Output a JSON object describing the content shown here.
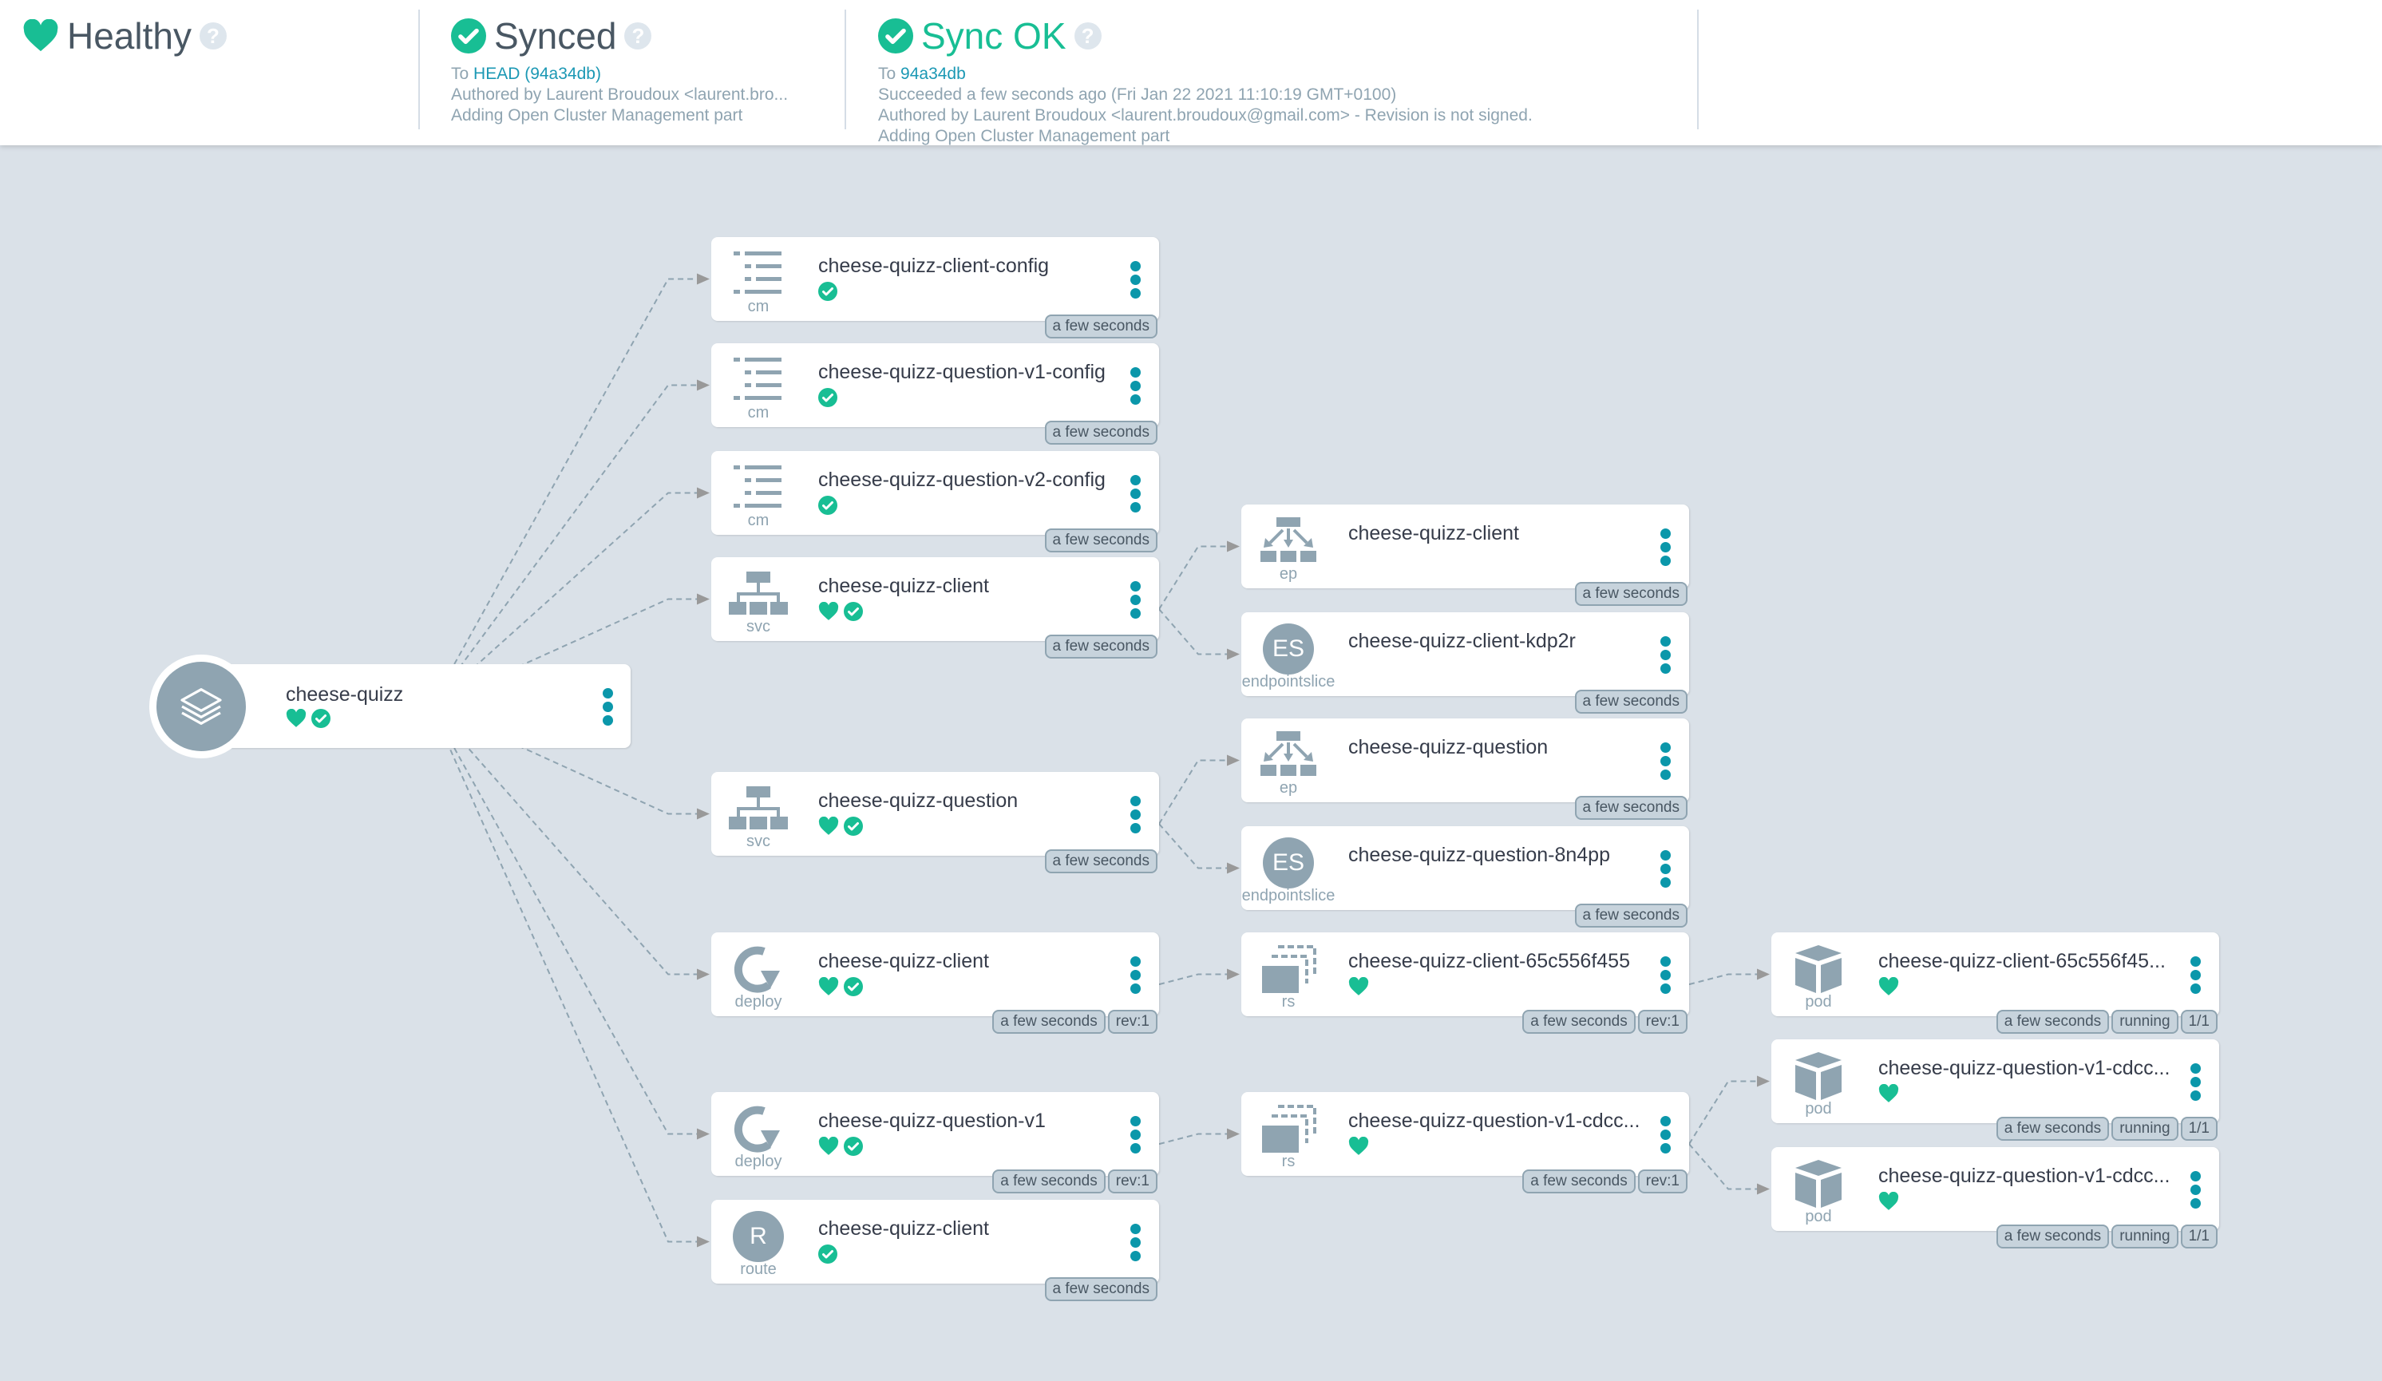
{
  "colors": {
    "healthy": "#18be94",
    "accent": "#0b97aa",
    "icon": "#8fa4b1",
    "link": "#0dadea"
  },
  "header": {
    "health": {
      "title": "Healthy",
      "icon": "heart-icon",
      "help_icon": "question-icon"
    },
    "sync": {
      "title": "Synced",
      "icon": "check-circle-icon",
      "to_prefix": "To",
      "to_link": "HEAD (94a34db)",
      "author": "Authored by Laurent Broudoux <laurent.bro...",
      "message": "Adding Open Cluster Management part"
    },
    "operation": {
      "title": "Sync OK",
      "icon": "check-circle-icon",
      "to_prefix": "To",
      "to_link": "94a34db",
      "succeeded": "Succeeded a few seconds ago (Fri Jan 22 2021 11:10:19 GMT+0100)",
      "author": "Authored by Laurent Broudoux <laurent.broudoux@gmail.com> - Revision is not signed.",
      "message": "Adding Open Cluster Management part"
    }
  },
  "root": {
    "name": "cheese-quizz",
    "icon": "layers-icon",
    "status": [
      "healthy",
      "synced"
    ]
  },
  "nodes": [
    {
      "id": "cm1",
      "kind": "cm",
      "icon": "configmap-icon",
      "name": "cheese-quizz-client-config",
      "status": [
        "synced"
      ],
      "tags": [
        "a few seconds"
      ]
    },
    {
      "id": "cm2",
      "kind": "cm",
      "icon": "configmap-icon",
      "name": "cheese-quizz-question-v1-config",
      "status": [
        "synced"
      ],
      "tags": [
        "a few seconds"
      ]
    },
    {
      "id": "cm3",
      "kind": "cm",
      "icon": "configmap-icon",
      "name": "cheese-quizz-question-v2-config",
      "status": [
        "synced"
      ],
      "tags": [
        "a few seconds"
      ]
    },
    {
      "id": "svc1",
      "kind": "svc",
      "icon": "service-icon",
      "name": "cheese-quizz-client",
      "status": [
        "healthy",
        "synced"
      ],
      "tags": [
        "a few seconds"
      ]
    },
    {
      "id": "svc2",
      "kind": "svc",
      "icon": "service-icon",
      "name": "cheese-quizz-question",
      "status": [
        "healthy",
        "synced"
      ],
      "tags": [
        "a few seconds"
      ]
    },
    {
      "id": "dep1",
      "kind": "deploy",
      "icon": "deploy-icon",
      "name": "cheese-quizz-client",
      "status": [
        "healthy",
        "synced"
      ],
      "tags": [
        "a few seconds",
        "rev:1"
      ]
    },
    {
      "id": "dep2",
      "kind": "deploy",
      "icon": "deploy-icon",
      "name": "cheese-quizz-question-v1",
      "status": [
        "healthy",
        "synced"
      ],
      "tags": [
        "a few seconds",
        "rev:1"
      ]
    },
    {
      "id": "route1",
      "kind": "route",
      "icon": "route-icon",
      "badge": "R",
      "name": "cheese-quizz-client",
      "status": [
        "synced"
      ],
      "tags": [
        "a few seconds"
      ]
    },
    {
      "id": "ep1",
      "kind": "ep",
      "icon": "endpoints-icon",
      "name": "cheese-quizz-client",
      "status": [],
      "tags": [
        "a few seconds"
      ]
    },
    {
      "id": "es1",
      "kind": "endpointslice",
      "icon": "endpointslice-icon",
      "badge": "ES",
      "name": "cheese-quizz-client-kdp2r",
      "status": [],
      "tags": [
        "a few seconds"
      ]
    },
    {
      "id": "ep2",
      "kind": "ep",
      "icon": "endpoints-icon",
      "name": "cheese-quizz-question",
      "status": [],
      "tags": [
        "a few seconds"
      ]
    },
    {
      "id": "es2",
      "kind": "endpointslice",
      "icon": "endpointslice-icon",
      "badge": "ES",
      "name": "cheese-quizz-question-8n4pp",
      "status": [],
      "tags": [
        "a few seconds"
      ]
    },
    {
      "id": "rs1",
      "kind": "rs",
      "icon": "replicaset-icon",
      "name": "cheese-quizz-client-65c556f455",
      "status": [
        "healthy"
      ],
      "tags": [
        "a few seconds",
        "rev:1"
      ]
    },
    {
      "id": "rs2",
      "kind": "rs",
      "icon": "replicaset-icon",
      "name": "cheese-quizz-question-v1-cdcc...",
      "status": [
        "healthy"
      ],
      "tags": [
        "a few seconds",
        "rev:1"
      ]
    },
    {
      "id": "pod1",
      "kind": "pod",
      "icon": "pod-icon",
      "name": "cheese-quizz-client-65c556f45...",
      "status": [
        "healthy"
      ],
      "tags": [
        "a few seconds",
        "running",
        "1/1"
      ]
    },
    {
      "id": "pod2",
      "kind": "pod",
      "icon": "pod-icon",
      "name": "cheese-quizz-question-v1-cdcc...",
      "status": [
        "healthy"
      ],
      "tags": [
        "a few seconds",
        "running",
        "1/1"
      ]
    },
    {
      "id": "pod3",
      "kind": "pod",
      "icon": "pod-icon",
      "name": "cheese-quizz-question-v1-cdcc...",
      "status": [
        "healthy"
      ],
      "tags": [
        "a few seconds",
        "running",
        "1/1"
      ]
    }
  ],
  "edges": [
    [
      "root",
      "cm1"
    ],
    [
      "root",
      "cm2"
    ],
    [
      "root",
      "cm3"
    ],
    [
      "root",
      "svc1"
    ],
    [
      "root",
      "svc2"
    ],
    [
      "root",
      "dep1"
    ],
    [
      "root",
      "dep2"
    ],
    [
      "root",
      "route1"
    ],
    [
      "svc1",
      "ep1"
    ],
    [
      "svc1",
      "es1"
    ],
    [
      "svc2",
      "ep2"
    ],
    [
      "svc2",
      "es2"
    ],
    [
      "dep1",
      "rs1"
    ],
    [
      "dep2",
      "rs2"
    ],
    [
      "rs1",
      "pod1"
    ],
    [
      "rs2",
      "pod2"
    ],
    [
      "rs2",
      "pod3"
    ]
  ]
}
